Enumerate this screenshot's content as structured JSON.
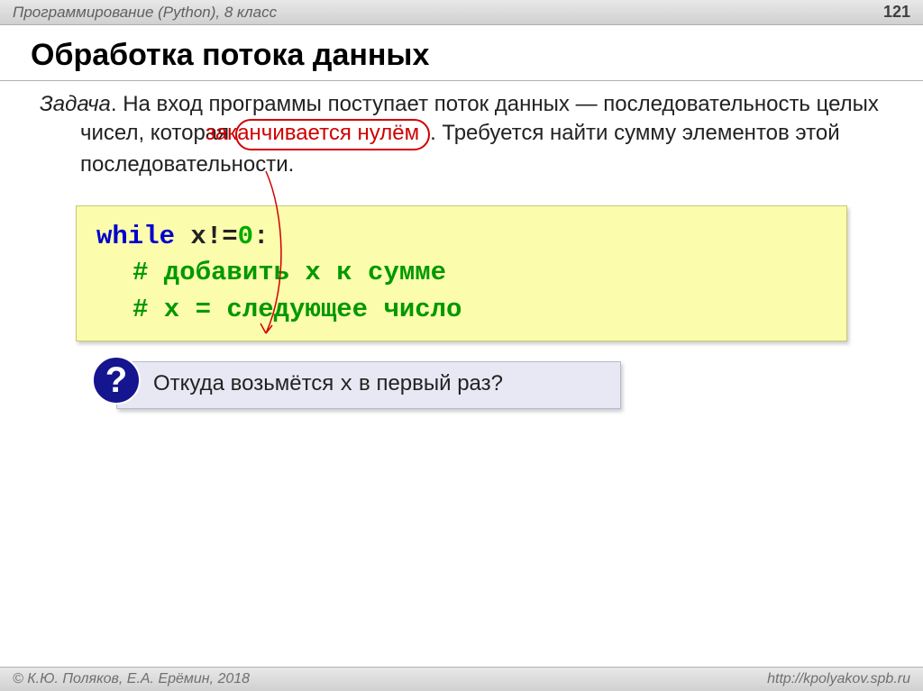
{
  "header": {
    "course_title": "Программирование (Python), 8 класс",
    "page_number": "121"
  },
  "slide": {
    "title": "Обработка потока данных",
    "task": {
      "label": "Задача",
      "text_before": ". На вход программы поступает поток данных — последовательность целых чисел, которая ",
      "highlighted": "заканчивается нулём",
      "text_after": ". Требуется найти сумму элементов этой последовательности."
    },
    "code": {
      "line1_while": "while",
      "line1_cond": " x!=",
      "line1_zero": "0",
      "line1_colon": ":",
      "line2": "# добавить x к сумме",
      "line3": "# x = следующее число"
    },
    "question": {
      "icon": "?",
      "text_before": "Откуда возьмётся ",
      "var": "x",
      "text_after": " в первый раз?"
    }
  },
  "footer": {
    "copyright": "© К.Ю. Поляков, Е.А. Ерёмин, 2018",
    "url": "http://kpolyakov.spb.ru"
  }
}
